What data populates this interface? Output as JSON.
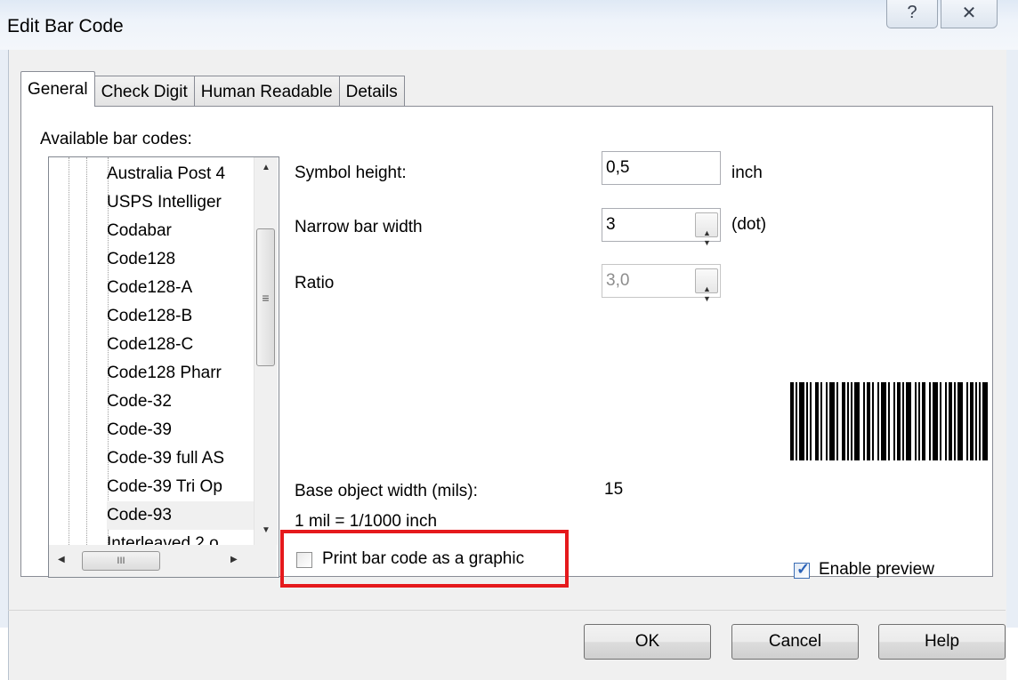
{
  "window": {
    "title": "Edit Bar Code",
    "help_glyph": "?",
    "close_glyph": "✕"
  },
  "tabs": [
    {
      "label": "General",
      "active": true
    },
    {
      "label": "Check Digit",
      "active": false
    },
    {
      "label": "Human Readable",
      "active": false
    },
    {
      "label": "Details",
      "active": false
    }
  ],
  "general": {
    "available_label": "Available bar codes:",
    "barcodes": [
      "Australia Post 4",
      "USPS Intelliger",
      "Codabar",
      "Code128",
      "Code128-A",
      "Code128-B",
      "Code128-C",
      "Code128 Pharr",
      "Code-32",
      "Code-39",
      "Code-39 full AS",
      "Code-39 Tri Op",
      "Code-93",
      "Interleaved 2 o"
    ],
    "selected_barcode": "Code-93",
    "symbol_height": {
      "label": "Symbol height:",
      "value": "0,5",
      "unit": "inch"
    },
    "narrow_bar_width": {
      "label": "Narrow bar width",
      "value": "3",
      "unit": "(dot)"
    },
    "ratio": {
      "label": "Ratio",
      "value": "3,0"
    },
    "base_width": {
      "label": "Base object width (mils):",
      "value": "15",
      "note": "1 mil = 1/1000 inch"
    },
    "print_graphic": {
      "label": "Print bar code as a graphic",
      "checked": false
    },
    "enable_preview": {
      "label": "Enable preview",
      "checked": true
    }
  },
  "buttons": {
    "ok": "OK",
    "cancel": "Cancel",
    "help": "Help"
  },
  "scroll_glyphs": {
    "grip_v": "≡",
    "grip_h": "III"
  },
  "colors": {
    "highlight_box": "#e5191c",
    "checkbox_checked": "#2a62b8"
  }
}
